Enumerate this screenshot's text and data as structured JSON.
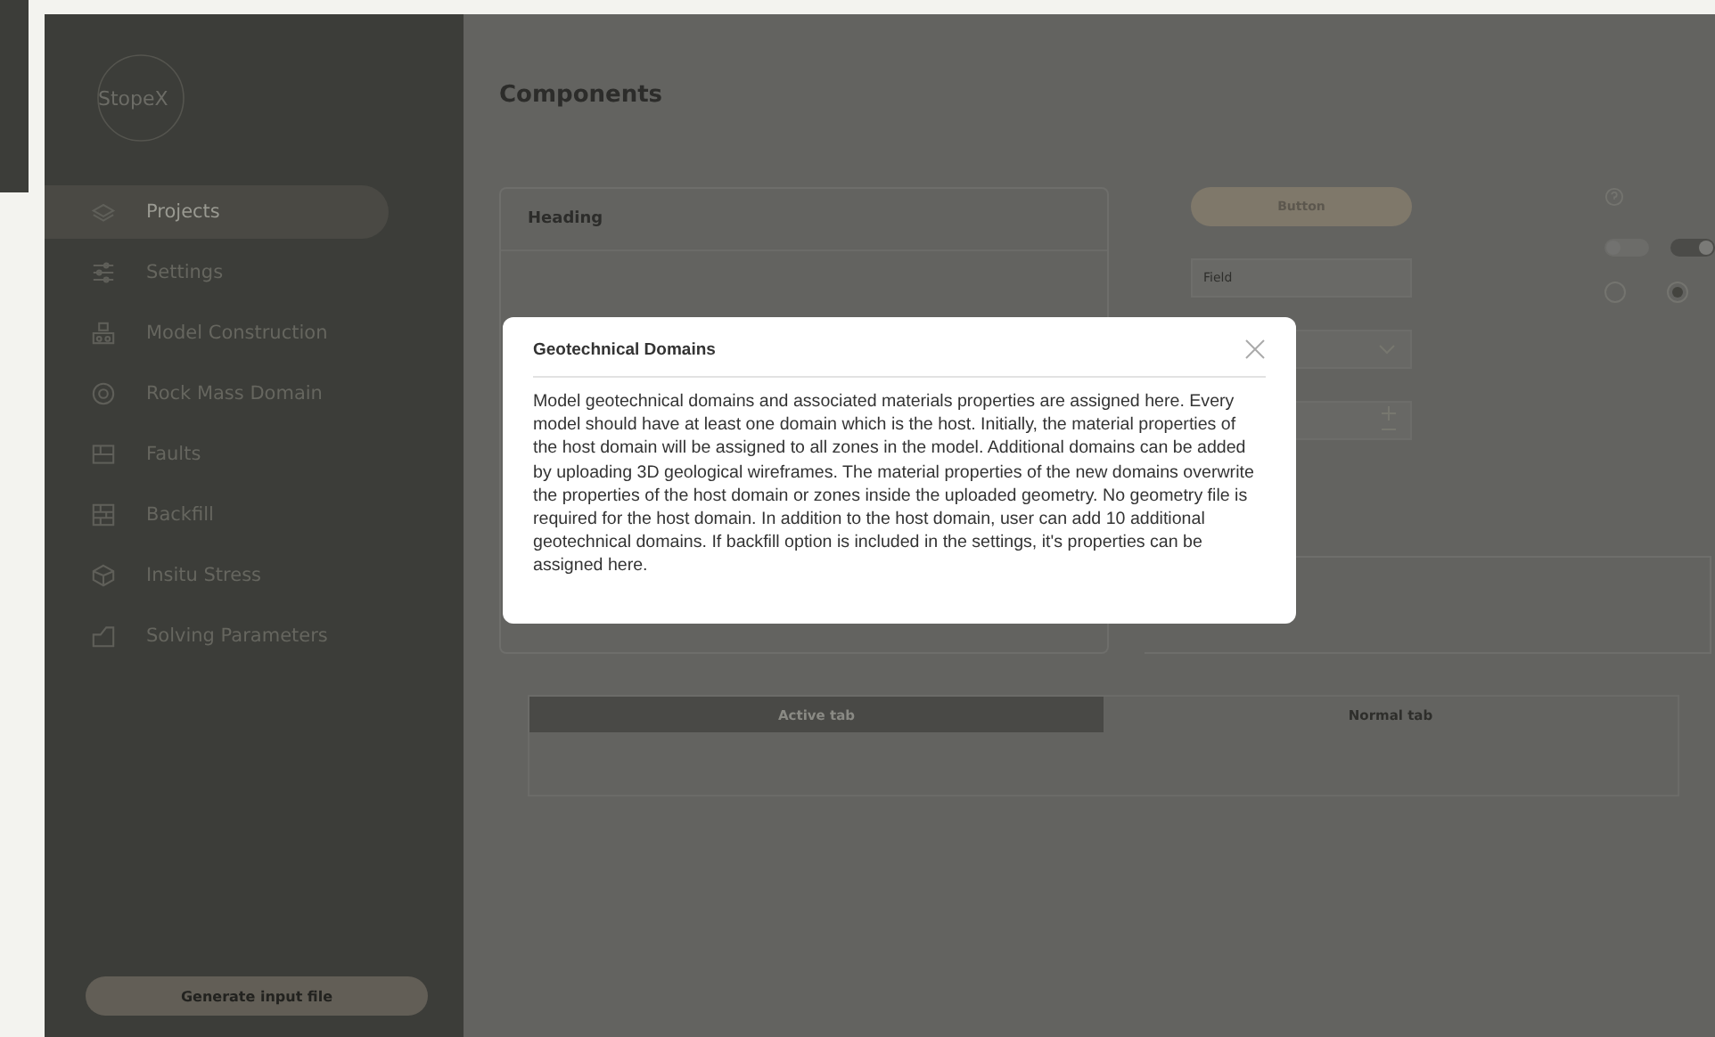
{
  "sidebar": {
    "logo": "StopeX",
    "items": [
      {
        "label": "Projects",
        "selected": true
      },
      {
        "label": "Settings",
        "selected": false
      },
      {
        "label": "Model Construction",
        "selected": false
      },
      {
        "label": "Rock Mass Domain",
        "selected": false
      },
      {
        "label": "Faults",
        "selected": false
      },
      {
        "label": "Backfill",
        "selected": false
      },
      {
        "label": "Insitu Stress",
        "selected": false
      },
      {
        "label": "Solving Parameters",
        "selected": false
      }
    ],
    "button": "Generate input file"
  },
  "main": {
    "title": "Components",
    "card": {
      "heading": "Heading"
    },
    "button": "Button",
    "field": {
      "placeholder": "Field"
    },
    "toggles": [
      {
        "on": false
      },
      {
        "on": true
      }
    ],
    "radios": [
      {
        "selected": false
      },
      {
        "selected": true
      }
    ],
    "tabs": [
      {
        "label": "Active tab",
        "selected": true
      },
      {
        "label": "Normal tab",
        "selected": false
      }
    ]
  },
  "dialog": {
    "title": "Geotechnical Domains",
    "body": "Model geotechnical domains and associated materials properties are assigned here. Every model should have at least one domain which is the host. Initially, the material properties of the host domain will be assigned to all zones in the model. Additional domains can be added by uploading 3D geological wireframes. The material properties of the new domains overwrite the properties of the host domain or zones inside the uploaded geometry. No geometry file is required for the host domain. In addition to the host domain, user can add 10 additional geotechnical domains. If backfill option is included in the settings, it's properties can be assigned here."
  }
}
